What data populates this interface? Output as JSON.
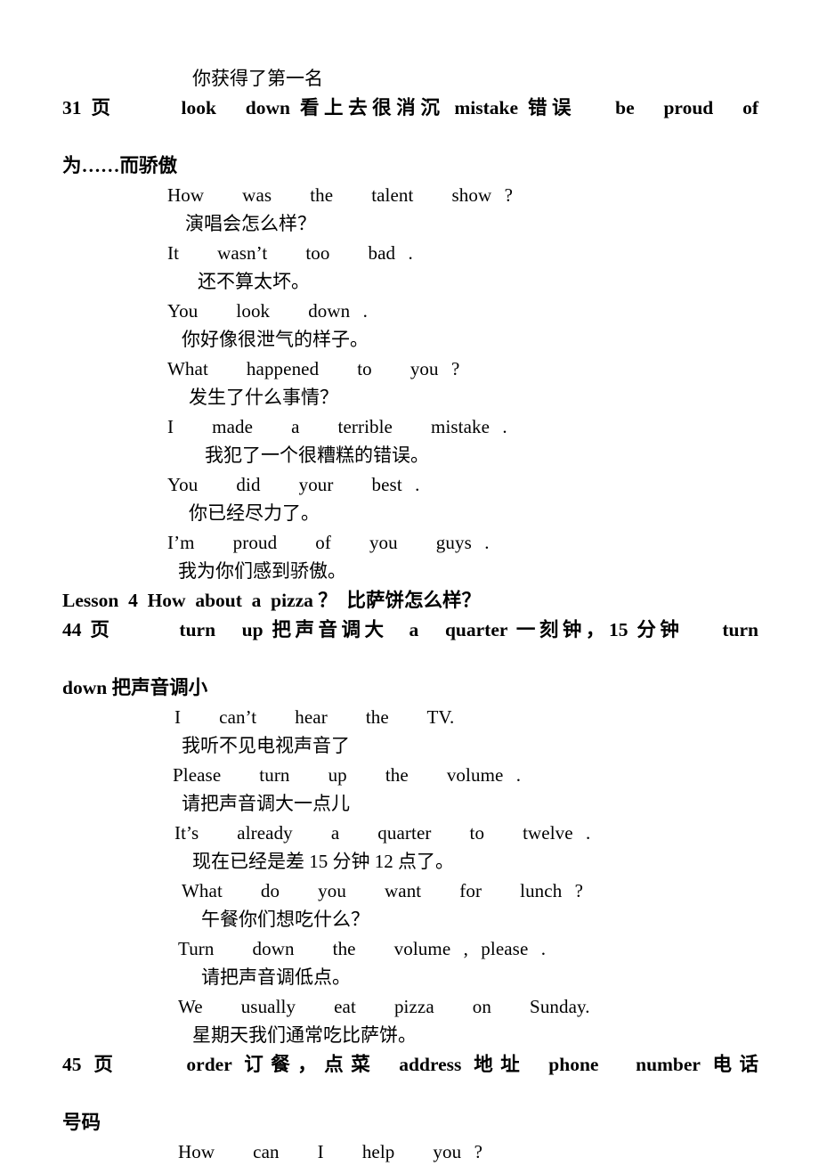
{
  "document": {
    "type": "study-notes",
    "language_pair": "English-Chinese",
    "opening_line": "你获得了第一名"
  },
  "sections": [
    {
      "heading": {
        "page_ref": "31 页",
        "vocabulary": [
          {
            "term": "look  down",
            "gloss": "看上去很消沉"
          },
          {
            "term": "mistake",
            "gloss": "错误"
          },
          {
            "term": "be  proud  of",
            "gloss": "为……而骄傲"
          }
        ],
        "line1": "31 页",
        "line1b": "look   down 看上去很消沉 mistake 错误",
        "line1c": "be   proud   of",
        "line2": "为……而骄傲"
      },
      "dialogue": [
        {
          "en": "How   was   the   talent   show ?",
          "zh": "演唱会怎么样？"
        },
        {
          "en": "It   wasn’t   too   bad .",
          "zh": "还不算太坏。"
        },
        {
          "en": "You   look   down .",
          "zh": "你好像很泄气的样子。"
        },
        {
          "en": "What   happened   to   you ?",
          "zh": "发生了什么事情？"
        },
        {
          "en": "I   made   a   terrible   mistake .",
          "zh": "我犯了一个很糟糕的错误。"
        },
        {
          "en": "You   did   your   best .",
          "zh": "你已经尽力了。"
        },
        {
          "en": "I’m   proud   of   you   guys .",
          "zh": "我为你们感到骄傲。"
        }
      ]
    },
    {
      "lesson_title": "Lesson  4  How  about  a  pizza ？  比萨饼怎么样？",
      "heading": {
        "page_ref": "44 页",
        "line1b": "turn   up 把声音调大",
        "line1c": "a   quarter 一刻钟，15 分钟",
        "line1d": "turn",
        "line2": "down 把声音调小",
        "vocabulary": [
          {
            "term": "turn  up",
            "gloss": "把声音调大"
          },
          {
            "term": "a  quarter",
            "gloss": "一刻钟，15 分钟"
          },
          {
            "term": "turn  down",
            "gloss": "把声音调小"
          }
        ]
      },
      "dialogue": [
        {
          "en": "I   can’t   hear   the   TV.",
          "zh": "我听不见电视声音了"
        },
        {
          "en": "Please   turn   up   the   volume .",
          "zh": "请把声音调大一点儿"
        },
        {
          "en": "It’s   already   a   quarter   to   twelve .",
          "zh": "现在已经是差 15 分钟 12 点了。"
        },
        {
          "en": "What   do   you   want   for   lunch ?",
          "zh": "午餐你们想吃什么？"
        },
        {
          "en": "Turn   down   the   volume , please .",
          "zh": "请把声音调低点。"
        },
        {
          "en": "We   usually   eat   pizza   on   Sunday.",
          "zh": "星期天我们通常吃比萨饼。"
        }
      ]
    },
    {
      "heading": {
        "page_ref": "45 页",
        "line1b": "order 订餐，点菜",
        "line1c": "address 地址",
        "line1d": "phone   number 电话",
        "line2": "号码",
        "vocabulary": [
          {
            "term": "order",
            "gloss": "订餐，点菜"
          },
          {
            "term": "address",
            "gloss": "地址"
          },
          {
            "term": "phone  number",
            "gloss": "电话号码"
          }
        ]
      },
      "dialogue": [
        {
          "en": "How   can   I   help   you ?",
          "zh": ""
        }
      ]
    }
  ]
}
